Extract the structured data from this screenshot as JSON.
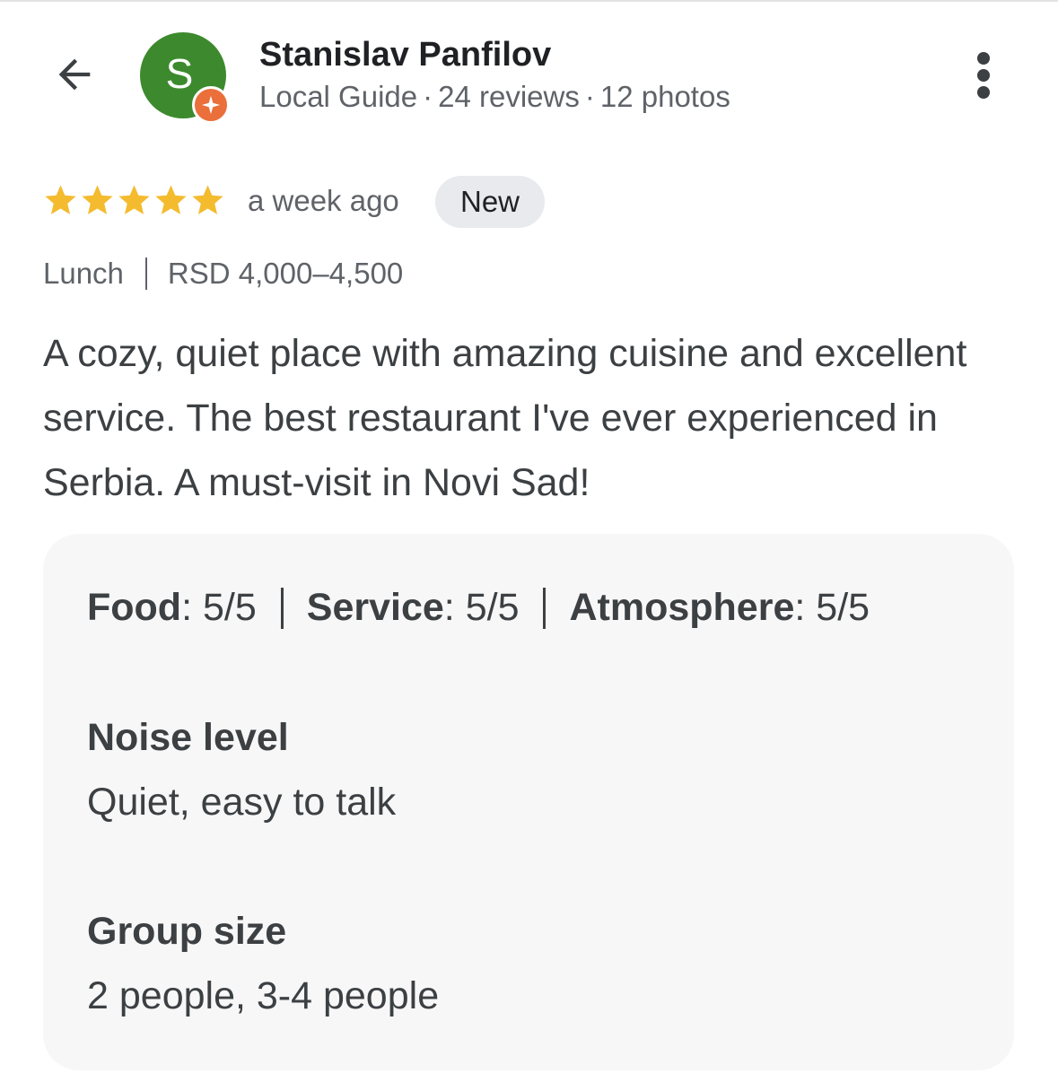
{
  "reviewer": {
    "name": "Stanislav Panfilov",
    "avatar_letter": "S",
    "avatar_color": "#3d8a2e",
    "badge_color": "#ea6f3a",
    "level": "Local Guide",
    "reviews": "24 reviews",
    "photos": "12 photos",
    "separator": "·"
  },
  "icons": {
    "back": "arrow-back-icon",
    "more": "more-vertical-icon",
    "star": "star-icon",
    "badge": "local-guide-star-icon"
  },
  "review": {
    "rating": 5,
    "rating_max": 5,
    "star_color": "#f4bb2f",
    "time": "a week ago",
    "badge": "New",
    "meal": "Lunch",
    "price": "RSD 4,000–4,500",
    "text": "A cozy, quiet place with amazing cuisine and excellent service. The best restaurant I've ever experienced in Serbia. A must-visit in Novi Sad!"
  },
  "details": {
    "ratings": [
      {
        "label": "Food",
        "value": "5/5"
      },
      {
        "label": "Service",
        "value": "5/5"
      },
      {
        "label": "Atmosphere",
        "value": "5/5"
      }
    ],
    "noise": {
      "title": "Noise level",
      "value": "Quiet, easy to talk"
    },
    "group": {
      "title": "Group size",
      "value": "2 people, 3-4 people"
    }
  }
}
